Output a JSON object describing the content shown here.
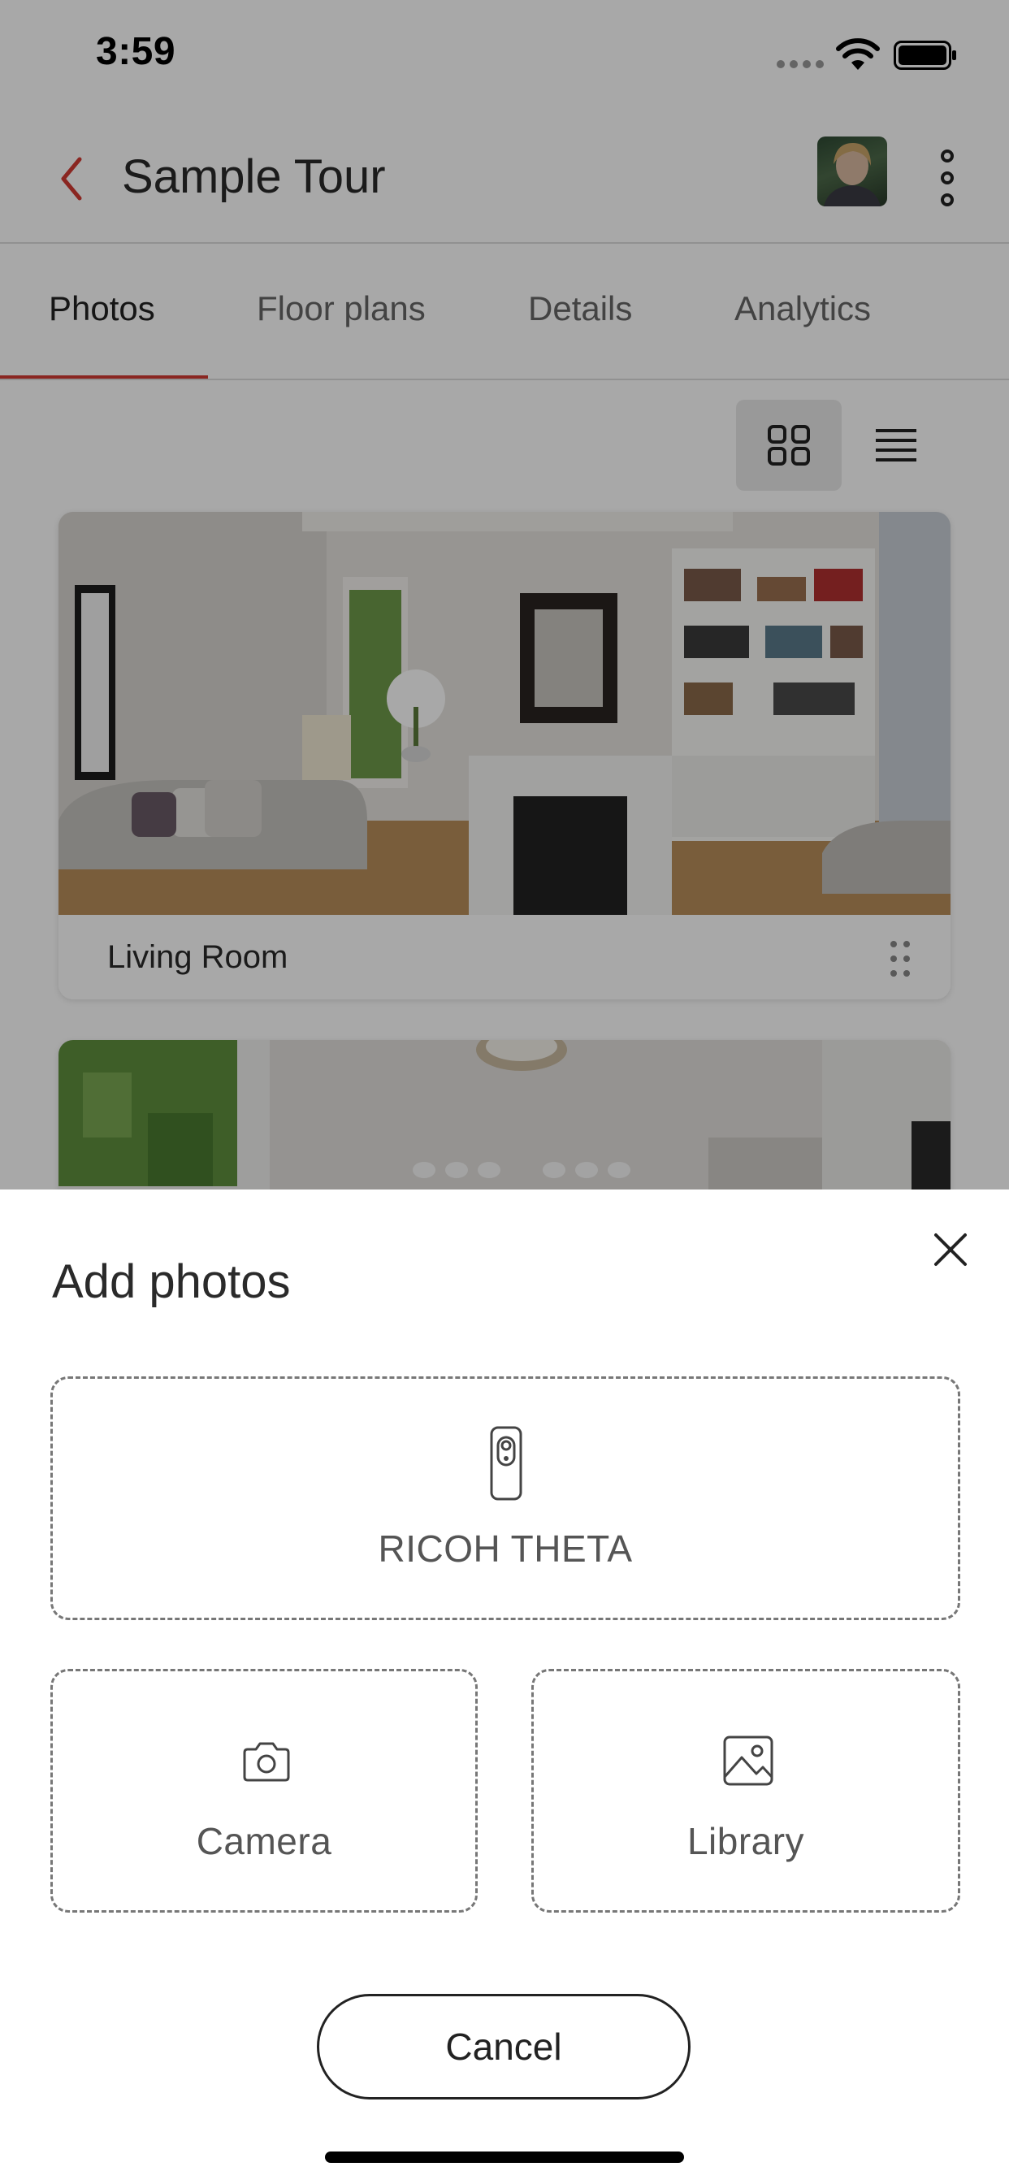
{
  "status_bar": {
    "time": "3:59"
  },
  "header": {
    "title": "Sample Tour"
  },
  "tabs": [
    {
      "label": "Photos"
    },
    {
      "label": "Floor plans"
    },
    {
      "label": "Details"
    },
    {
      "label": "Analytics"
    }
  ],
  "photos": [
    {
      "label": "Living Room"
    }
  ],
  "sheet": {
    "title": "Add photos",
    "options": {
      "ricoh": "RICOH THETA",
      "camera": "Camera",
      "library": "Library"
    },
    "cancel_label": "Cancel"
  },
  "colors": {
    "accent": "#d23a33",
    "overlay": "rgba(0,0,0,0.34)"
  },
  "icons": [
    "wifi-icon",
    "battery-icon",
    "back-icon",
    "more-icon",
    "grid-view-icon",
    "list-view-icon",
    "drag-handle-icon",
    "close-icon",
    "ricoh-theta-icon",
    "camera-icon",
    "library-icon"
  ]
}
